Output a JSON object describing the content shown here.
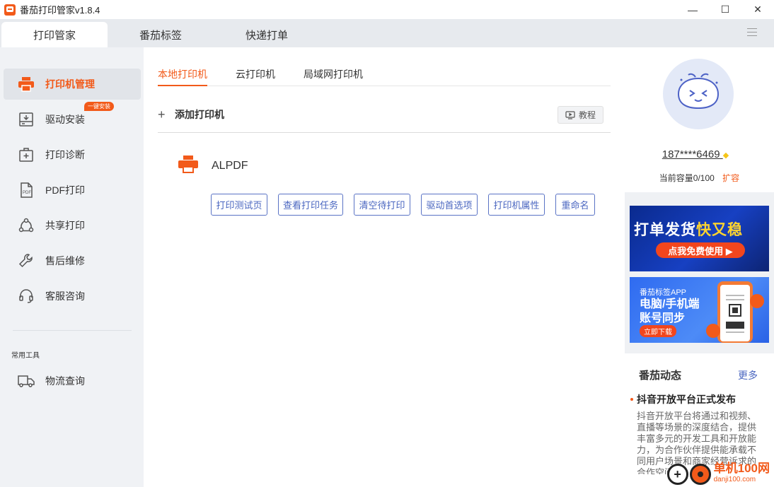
{
  "window": {
    "title": "番茄打印管家v1.8.4",
    "minimize": "—",
    "maximize": "☐",
    "close": "✕"
  },
  "top_tabs": [
    {
      "label": "打印管家",
      "active": true
    },
    {
      "label": "番茄标签",
      "active": false
    },
    {
      "label": "快递打单",
      "active": false
    }
  ],
  "sidebar": {
    "items": [
      {
        "label": "打印机管理",
        "icon": "printer-icon",
        "active": true
      },
      {
        "label": "驱动安装",
        "icon": "driver-install-icon",
        "badge": "一键安装"
      },
      {
        "label": "打印诊断",
        "icon": "diagnose-icon"
      },
      {
        "label": "PDF打印",
        "icon": "pdf-icon"
      },
      {
        "label": "共享打印",
        "icon": "share-icon"
      },
      {
        "label": "售后维修",
        "icon": "wrench-icon"
      },
      {
        "label": "客服咨询",
        "icon": "headset-icon"
      }
    ],
    "section_title": "常用工具",
    "tools": [
      {
        "label": "物流查询",
        "icon": "truck-icon"
      }
    ]
  },
  "main": {
    "sub_tabs": [
      {
        "label": "本地打印机",
        "active": true
      },
      {
        "label": "云打印机",
        "active": false
      },
      {
        "label": "局域网打印机",
        "active": false
      }
    ],
    "add_printer_label": "添加打印机",
    "tutorial_label": "教程",
    "printer": {
      "name": "ALPDF",
      "actions": [
        "打印测试页",
        "查看打印任务",
        "清空待打印",
        "驱动首选项",
        "打印机属性",
        "重命名"
      ]
    }
  },
  "profile": {
    "username": "187****6469",
    "capacity": "当前容量0/100",
    "expand_label": "扩容"
  },
  "banners": {
    "banner1": {
      "title_part1": "打单发货",
      "title_part2": "快又稳",
      "button": "点我免费使用 ▶"
    },
    "banner2": {
      "subtitle": "番茄标签APP",
      "title": "电脑/手机端账号同步",
      "button": "立即下载"
    }
  },
  "news": {
    "title": "番茄动态",
    "more": "更多",
    "headline": "抖音开放平台正式发布",
    "body": "抖音开放平台将通过和视频、直播等场景的深度结合，提供丰富多元的开发工具和开放能力，为合作伙伴提供能承载不同用户场景和商家经营诉求的合作空间。"
  },
  "watermark": {
    "main": "单机100网",
    "sub": "danji100.com"
  },
  "colors": {
    "accent": "#f25a1a",
    "link": "#4a66c0",
    "sidebar_bg": "#f0f2f5"
  }
}
